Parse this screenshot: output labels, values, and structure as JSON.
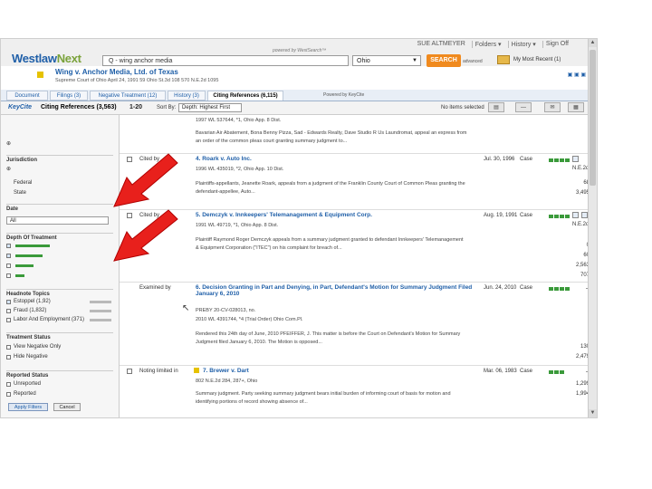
{
  "header": {
    "usernav": [
      "SUE ALTMEYER",
      "Folders ▾",
      "History ▾",
      "Sign Off"
    ],
    "logo_main": "Westlaw",
    "logo_next": "Next",
    "powered": "powered by WestSearch™",
    "search_value": "Q - wing anchor media",
    "jurisdiction": "Ohio",
    "search_button": "SEARCH",
    "advanced": "advanced",
    "recent": "My Most Recent (1)"
  },
  "case": {
    "title": "Wing v. Anchor Media, Ltd. of Texas",
    "sub": "Supreme Court of Ohio    April 24, 1991    59 Ohio St.3d 108    570 N.E.2d 1095",
    "links": "▣ ▣ ▣"
  },
  "tabs": [
    {
      "label": "Document"
    },
    {
      "label": "Filings (3)"
    },
    {
      "label": "Negative Treatment (12)"
    },
    {
      "label": "History (3)"
    },
    {
      "label": "Citing References (6,115)"
    }
  ],
  "tabs_powered": "Powered by KeyCite",
  "toolbar": {
    "keycite": "KeyCite",
    "title": "Citing References (3,563)",
    "range": "1-20",
    "sort_label": "Sort By:",
    "sort_value": "Depth: Highest First",
    "selected": "No items selected"
  },
  "sidebar": {
    "jurisdiction_head": "Jurisdiction",
    "federal": "Federal",
    "federal_count": "68",
    "state": "State",
    "state_count": "3,495",
    "date_head": "Date",
    "date_value": "All",
    "depth_head": "Depth Of Treatment",
    "depth_counts": [
      "0",
      "60",
      "2,563",
      "707"
    ],
    "headnote_head": "Headnote Topics",
    "hn1": "Estoppel (1,92)",
    "hn2": "Fraud (1,832)",
    "hn3": "Labor And Employment (371)",
    "treat_head": "Treatment Status",
    "view_neg": "View Negative Only",
    "view_neg_count": "130",
    "hide_neg": "Hide Negative",
    "hide_neg_count": "2,479",
    "reported_head": "Reported Status",
    "unreported": "Unreported",
    "unreported_count": "1,299",
    "reported": "Reported",
    "reported_count": "1,994",
    "apply": "Apply Filters",
    "cancel": "Cancel"
  },
  "results": [
    {
      "treat": "",
      "title": "",
      "lines": [
        "1997 WL 537644, *1, Ohio App. 8 Dist.",
        "Bavarian Air Abatement, Bona Benny Pizza, Sad - Edwards Realty, Dave Studio R Us Laundromat, appeal an express from an order of the common pleas court granting summary judgment to..."
      ],
      "date": "",
      "type": "",
      "hn": ""
    },
    {
      "treat": "Cited by",
      "title": "4. Roark v. Auto Inc.",
      "lines": [
        "1996 WL 435019, *2, Ohio App. 10 Dist.",
        "Plaintiffs-appellants, Jeanette Roark, appeals from a judgment of the Franklin County Court of Common Pleas granting the defendant-appellee, Auto..."
      ],
      "date": "Jul. 30, 1996",
      "type": "Case",
      "hn": "N.E.2d"
    },
    {
      "treat": "Cited by",
      "title": "5. Demczyk v. Innkeepers' Telemanagement & Equipment Corp.",
      "lines": [
        "1991 WL 49719, *1, Ohio App. 8 Dist.",
        "Plaintiff Raymond Roger Demczyk appeals from a summary judgment granted to defendant Innkeepers' Telemanagement & Equipment Corporation (\"ITEC\") on his complaint for breach of..."
      ],
      "date": "Aug. 19, 1991",
      "type": "Case",
      "hn": "N.E.2d"
    },
    {
      "treat": "Examined by",
      "title": "6. Decision Granting in Part and Denying, in Part, Defendant's Motion for Summary Judgment Filed January 6, 2010",
      "lines": [
        "PREBY 20-CV-028013, no.",
        "2010 WL 4391744, *4 (Trial Order) Ohio Com.Pl.",
        "Rendered this 24th day of June, 2010 PFEIFFER, J. This matter is before the Court on Defendant's Motion for Summary Judgment filed January 6, 2010. The Motion is opposed..."
      ],
      "date": "Jun. 24, 2010",
      "type": "Case",
      "hn": "—"
    },
    {
      "treat": "Noting limited in",
      "title": "7. Brewer v. Dart",
      "lines": [
        "802 N.E.2d 284, 287+, Ohio",
        "Summary judgment. Party seeking summary judgment bears initial burden of informing court of basis for motion and identifying portions of record showing absence of..."
      ],
      "date": "Mar. 06, 1983",
      "type": "Case",
      "hn": "—"
    }
  ]
}
